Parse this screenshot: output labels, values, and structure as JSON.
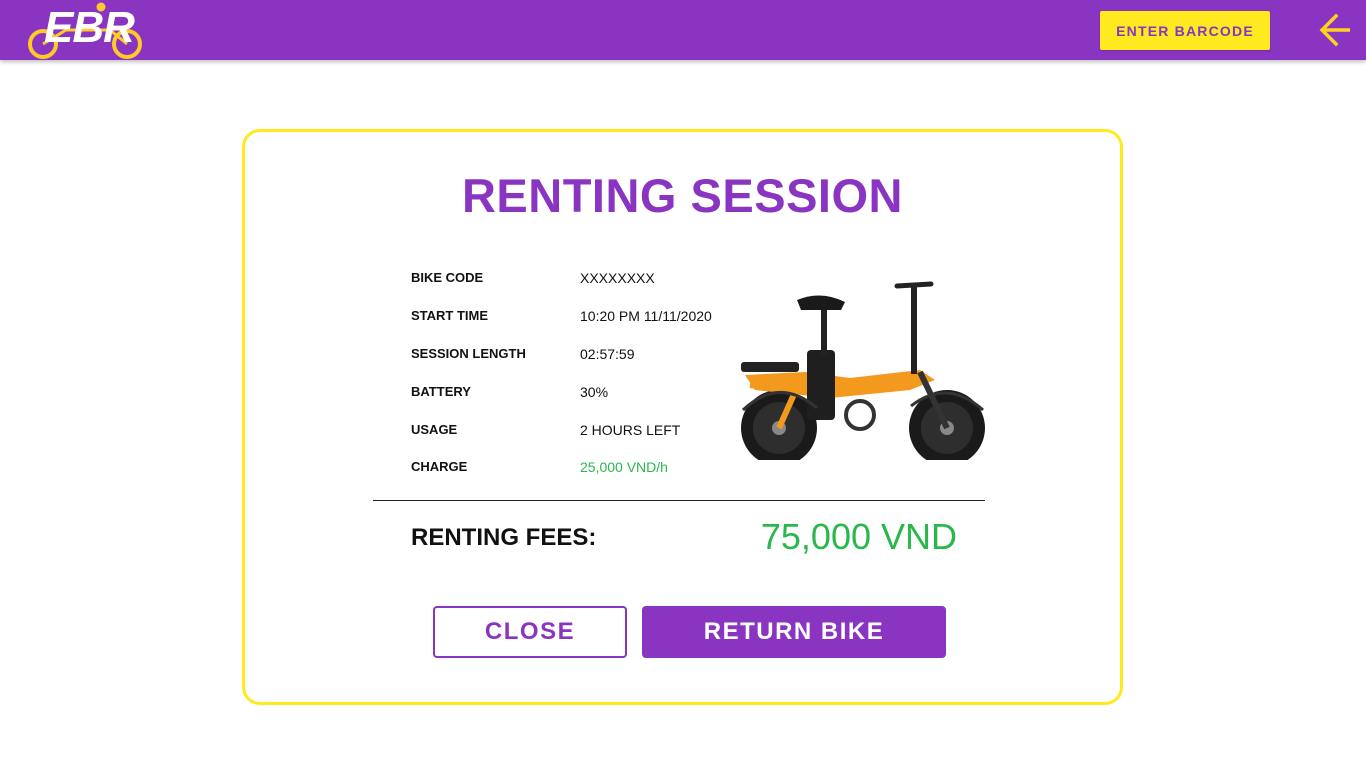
{
  "header": {
    "logo_text": "EBR",
    "enter_barcode_label": "ENTER BARCODE",
    "back_icon": "arrow-left-icon"
  },
  "session": {
    "title": "RENTING SESSION",
    "rows": [
      {
        "label": "BIKE CODE",
        "value": "XXXXXXXX"
      },
      {
        "label": "START TIME",
        "value": "10:20 PM 11/11/2020"
      },
      {
        "label": "SESSION LENGTH",
        "value": "02:57:59"
      },
      {
        "label": "BATTERY",
        "value": "30%"
      },
      {
        "label": "USAGE",
        "value": "2 HOURS LEFT"
      },
      {
        "label": "CHARGE",
        "value": "25,000 VND/h"
      }
    ],
    "fees_label": "RENTING FEES:",
    "fees_value": "75,000 VND",
    "close_label": "CLOSE",
    "return_label": "RETURN BIKE"
  },
  "colors": {
    "brand_purple": "#8a35c2",
    "accent_yellow": "#ffea1f",
    "money_green": "#2ab84c"
  }
}
